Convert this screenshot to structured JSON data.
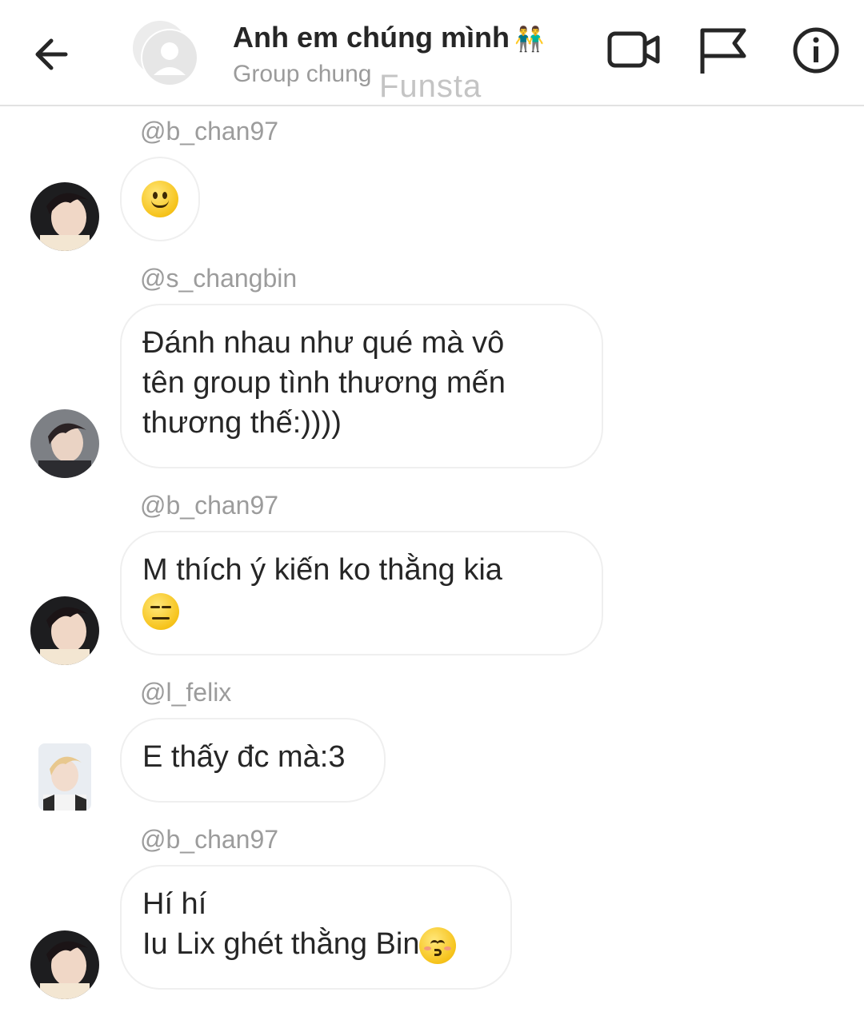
{
  "header": {
    "title": "Anh em chúng mình",
    "title_emoji": "👬",
    "subtitle": "Group chung",
    "watermark": "Funsta",
    "icons": [
      "back-arrow-icon",
      "group-avatar-icon",
      "video-call-icon",
      "flag-icon",
      "info-icon"
    ]
  },
  "messages": [
    {
      "sender": "@b_chan97",
      "lines": [],
      "emoji": "slightly-smiling-face"
    },
    {
      "sender": "@s_changbin",
      "lines": [
        "Đánh nhau như qué mà vô",
        "tên group tình thương mến",
        "thương thế:))))"
      ]
    },
    {
      "sender": "@b_chan97",
      "lines": [
        "M thích ý kiến ko thằng kia"
      ],
      "emoji": "expressionless-face"
    },
    {
      "sender": "@l_felix",
      "lines": [
        "E thấy đc mà:3"
      ]
    },
    {
      "sender": "@b_chan97",
      "lines": [
        "Hí hí",
        "Iu Lix ghét thằng Bin"
      ],
      "emoji": "kissing-face-smiling-eyes"
    }
  ],
  "colors": {
    "text": "#262626",
    "secondary_text": "#9c9c9c",
    "bubble_border": "#efefef",
    "divider": "#e2e2e2"
  }
}
